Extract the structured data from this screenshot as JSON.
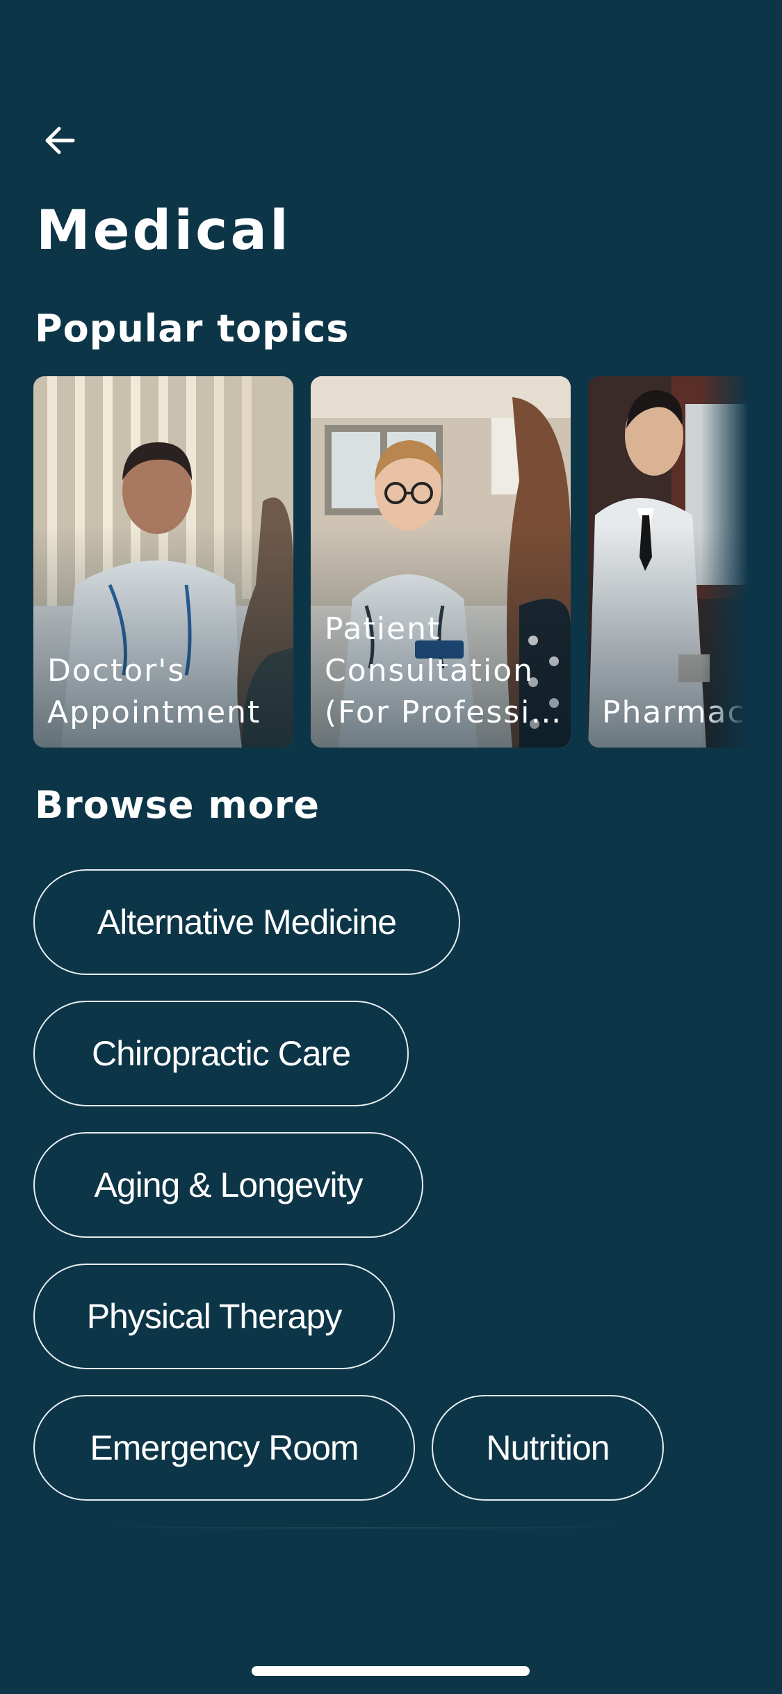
{
  "header": {
    "back_icon": "arrow-left-icon",
    "title": "Medical"
  },
  "popular": {
    "heading": "Popular topics",
    "cards": [
      {
        "label_lines": [
          "Doctor's",
          "Appointment"
        ],
        "image": "doctor-with-patient-photo"
      },
      {
        "label_lines": [
          "Patient",
          "Consultation",
          "(For Professio..."
        ],
        "image": "smiling-doctor-photo"
      },
      {
        "label_lines": [
          "Pharmac"
        ],
        "image": "pharmacist-photo"
      }
    ]
  },
  "browse": {
    "heading": "Browse more",
    "chips": [
      "Alternative Medicine",
      "Chiropractic Care",
      "Aging & Longevity",
      "Physical Therapy",
      "Emergency Room",
      "Nutrition"
    ]
  },
  "colors": {
    "background": "#0d3548",
    "text": "#ffffff",
    "chip_border": "#e6eef2"
  }
}
